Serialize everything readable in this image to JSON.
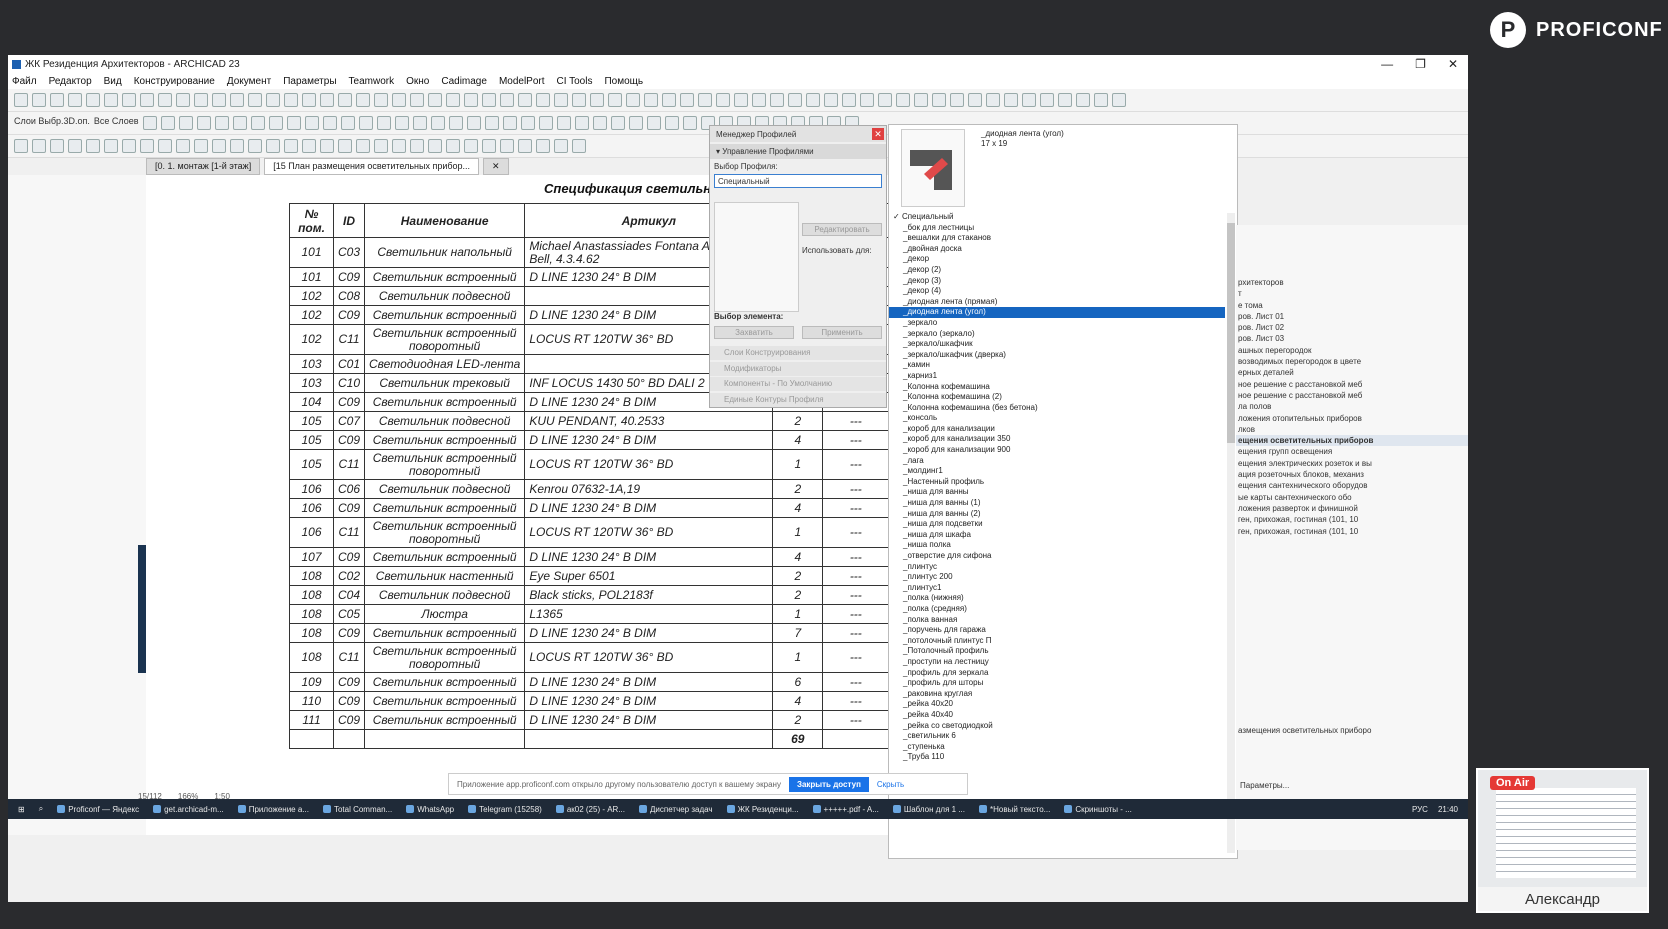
{
  "brand": {
    "logo_letter": "P",
    "name": "PROFICONF"
  },
  "window": {
    "title": "ЖК Резиденция Архитекторов - ARCHICAD 23",
    "min": "—",
    "max": "❐",
    "close": "✕"
  },
  "menu": [
    "Файл",
    "Редактор",
    "Вид",
    "Конструирование",
    "Документ",
    "Параметры",
    "Teamwork",
    "Окно",
    "Cadimage",
    "ModelPort",
    "CI Tools",
    "Помощь"
  ],
  "toolbar2": {
    "layer_combo": "Слои Выбр.3D.оп.",
    "all_layers": "Все Слоев"
  },
  "tabs": [
    {
      "label": "[0. 1. монтаж [1-й этаж]",
      "active": false
    },
    {
      "label": "[15 План размещения осветительных прибор...",
      "active": true
    },
    {
      "label": "✕",
      "active": false
    }
  ],
  "schedule": {
    "title": "Спецификация светильников",
    "headers": [
      "№ пом.",
      "ID",
      "Наименование",
      "Артикул",
      "",
      ""
    ],
    "rows": [
      {
        "room": "101",
        "id": "C03",
        "name": "Светильник напольный",
        "article": "Michael Anastassiades Fontana Amoroso Bell, 4.3.4.62",
        "qty": "",
        "note": "",
        "tall": true
      },
      {
        "room": "101",
        "id": "C09",
        "name": "Светильник встроенный",
        "article": "D LINE 1230 24° B DIM",
        "qty": "",
        "note": "",
        "tall": false
      },
      {
        "room": "102",
        "id": "C08",
        "name": "Светильник подвесной",
        "article": "",
        "qty": "",
        "note": "",
        "tall": false
      },
      {
        "room": "102",
        "id": "C09",
        "name": "Светильник встроенный",
        "article": "D LINE 1230 24° B DIM",
        "qty": "",
        "note": "",
        "tall": false
      },
      {
        "room": "102",
        "id": "C11",
        "name": "Светильник встроенный поворотный",
        "article": "LOCUS RT 120TW 36° BD",
        "qty": "",
        "note": "",
        "tall": true
      },
      {
        "room": "103",
        "id": "C01",
        "name": "Светодиодная LED-лента",
        "article": "",
        "qty": "",
        "note": "",
        "tall": false
      },
      {
        "room": "103",
        "id": "C10",
        "name": "Светильник трековый",
        "article": "INF LOCUS 1430 50° BD DALI 2",
        "qty": "2",
        "note": "",
        "tall": false
      },
      {
        "room": "104",
        "id": "C09",
        "name": "Светильник встроенный",
        "article": "D LINE 1230 24° B DIM",
        "qty": "",
        "note": "---",
        "tall": false
      },
      {
        "room": "105",
        "id": "C07",
        "name": "Светильник подвесной",
        "article": "KUU PENDANT, 40.2533",
        "qty": "2",
        "note": "---",
        "tall": false
      },
      {
        "room": "105",
        "id": "C09",
        "name": "Светильник встроенный",
        "article": "D LINE 1230 24° B DIM",
        "qty": "4",
        "note": "---",
        "tall": false
      },
      {
        "room": "105",
        "id": "C11",
        "name": "Светильник встроенный поворотный",
        "article": "LOCUS RT 120TW 36° BD",
        "qty": "1",
        "note": "---",
        "tall": true
      },
      {
        "room": "106",
        "id": "C06",
        "name": "Светильник подвесной",
        "article": "Kenrou 07632-1A,19",
        "qty": "2",
        "note": "---",
        "tall": false
      },
      {
        "room": "106",
        "id": "C09",
        "name": "Светильник встроенный",
        "article": "D LINE 1230 24° B DIM",
        "qty": "4",
        "note": "---",
        "tall": false
      },
      {
        "room": "106",
        "id": "C11",
        "name": "Светильник встроенный поворотный",
        "article": "LOCUS RT 120TW 36° BD",
        "qty": "1",
        "note": "---",
        "tall": true
      },
      {
        "room": "107",
        "id": "C09",
        "name": "Светильник встроенный",
        "article": "D LINE 1230 24° B DIM",
        "qty": "4",
        "note": "---",
        "tall": false
      },
      {
        "room": "108",
        "id": "C02",
        "name": "Светильник настенный",
        "article": "Eye Super 6501",
        "qty": "2",
        "note": "---",
        "tall": false
      },
      {
        "room": "108",
        "id": "C04",
        "name": "Светильник подвесной",
        "article": "Black sticks, POL2183f",
        "qty": "2",
        "note": "---",
        "tall": false
      },
      {
        "room": "108",
        "id": "C05",
        "name": "Люстра",
        "article": "L1365",
        "qty": "1",
        "note": "---",
        "tall": false
      },
      {
        "room": "108",
        "id": "C09",
        "name": "Светильник встроенный",
        "article": "D LINE 1230 24° B DIM",
        "qty": "7",
        "note": "---",
        "tall": false
      },
      {
        "room": "108",
        "id": "C11",
        "name": "Светильник встроенный поворотный",
        "article": "LOCUS RT 120TW 36° BD",
        "qty": "1",
        "note": "---",
        "tall": true
      },
      {
        "room": "109",
        "id": "C09",
        "name": "Светильник встроенный",
        "article": "D LINE 1230 24° B DIM",
        "qty": "6",
        "note": "---",
        "tall": false
      },
      {
        "room": "110",
        "id": "C09",
        "name": "Светильник встроенный",
        "article": "D LINE 1230 24° B DIM",
        "qty": "4",
        "note": "---",
        "tall": false
      },
      {
        "room": "111",
        "id": "C09",
        "name": "Светильник встроенный",
        "article": "D LINE 1230 24° B DIM",
        "qty": "2",
        "note": "---",
        "tall": false
      }
    ],
    "total": "69"
  },
  "profile_manager": {
    "title": "Менеджер Профилей",
    "close": "✕",
    "section": "Управление Профилями",
    "select_label": "Выбор Профиля:",
    "selected": "Специальный",
    "edit_btn": "Редактировать",
    "use_for": "Использовать для:",
    "element_choice": "Выбор элемента:",
    "capture_btn": "Захватить",
    "apply_btn": "Применить",
    "rows": [
      "Слои Конструирования",
      "Модификаторы",
      "Компоненты - По Умолчанию",
      "Единые Контуры Профиля"
    ]
  },
  "profile_list": {
    "preview_name": "_диодная лента (угол)",
    "dims": "17 x 19",
    "items": [
      {
        "label": "Специальный",
        "checked": true,
        "selected": false
      },
      {
        "label": "_бок для лестницы",
        "checked": false,
        "selected": false
      },
      {
        "label": "_вешалки для стаканов",
        "checked": false,
        "selected": false
      },
      {
        "label": "_двойная доска",
        "checked": false,
        "selected": false
      },
      {
        "label": "_декор",
        "checked": false,
        "selected": false
      },
      {
        "label": "_декор (2)",
        "checked": false,
        "selected": false
      },
      {
        "label": "_декор (3)",
        "checked": false,
        "selected": false
      },
      {
        "label": "_декор (4)",
        "checked": false,
        "selected": false
      },
      {
        "label": "_диодная лента (прямая)",
        "checked": false,
        "selected": false
      },
      {
        "label": "_диодная лента (угол)",
        "checked": false,
        "selected": true
      },
      {
        "label": "_зеркало",
        "checked": false,
        "selected": false
      },
      {
        "label": "_зеркало (зеркало)",
        "checked": false,
        "selected": false
      },
      {
        "label": "_зеркало/шкафчик",
        "checked": false,
        "selected": false
      },
      {
        "label": "_зеркало/шкафчик (дверка)",
        "checked": false,
        "selected": false
      },
      {
        "label": "_камин",
        "checked": false,
        "selected": false
      },
      {
        "label": "_карниз1",
        "checked": false,
        "selected": false
      },
      {
        "label": "_Колонна кофемашина",
        "checked": false,
        "selected": false
      },
      {
        "label": "_Колонна кофемашина (2)",
        "checked": false,
        "selected": false
      },
      {
        "label": "_Колонна кофемашина (без бетона)",
        "checked": false,
        "selected": false
      },
      {
        "label": "_консоль",
        "checked": false,
        "selected": false
      },
      {
        "label": "_короб для канализации",
        "checked": false,
        "selected": false
      },
      {
        "label": "_короб для канализации 350",
        "checked": false,
        "selected": false
      },
      {
        "label": "_короб для канализации 900",
        "checked": false,
        "selected": false
      },
      {
        "label": "_лага",
        "checked": false,
        "selected": false
      },
      {
        "label": "_молдинг1",
        "checked": false,
        "selected": false
      },
      {
        "label": "_Настенный профиль",
        "checked": false,
        "selected": false
      },
      {
        "label": "_ниша для ванны",
        "checked": false,
        "selected": false
      },
      {
        "label": "_ниша для ванны (1)",
        "checked": false,
        "selected": false
      },
      {
        "label": "_ниша для ванны (2)",
        "checked": false,
        "selected": false
      },
      {
        "label": "_ниша для подсветки",
        "checked": false,
        "selected": false
      },
      {
        "label": "_ниша для шкафа",
        "checked": false,
        "selected": false
      },
      {
        "label": "_ниша полка",
        "checked": false,
        "selected": false
      },
      {
        "label": "_отверстие для сифона",
        "checked": false,
        "selected": false
      },
      {
        "label": "_плинтус",
        "checked": false,
        "selected": false
      },
      {
        "label": "_плинтус 200",
        "checked": false,
        "selected": false
      },
      {
        "label": "_плинтус1",
        "checked": false,
        "selected": false
      },
      {
        "label": "_полка (нижняя)",
        "checked": false,
        "selected": false
      },
      {
        "label": "_полка (средняя)",
        "checked": false,
        "selected": false
      },
      {
        "label": "_полка ванная",
        "checked": false,
        "selected": false
      },
      {
        "label": "_поручень для гаража",
        "checked": false,
        "selected": false
      },
      {
        "label": "_потолочный плинтус П",
        "checked": false,
        "selected": false
      },
      {
        "label": "_Потолочный профиль",
        "checked": false,
        "selected": false
      },
      {
        "label": "_проступи на лестницу",
        "checked": false,
        "selected": false
      },
      {
        "label": "_профиль для зеркала",
        "checked": false,
        "selected": false
      },
      {
        "label": "_профиль для шторы",
        "checked": false,
        "selected": false
      },
      {
        "label": "_раковина круглая",
        "checked": false,
        "selected": false
      },
      {
        "label": "_рейка 40x20",
        "checked": false,
        "selected": false
      },
      {
        "label": "_рейка 40x40",
        "checked": false,
        "selected": false
      },
      {
        "label": "_рейка со светодиодкой",
        "checked": false,
        "selected": false
      },
      {
        "label": "_светильник 6",
        "checked": false,
        "selected": false
      },
      {
        "label": "_ступенька",
        "checked": false,
        "selected": false
      },
      {
        "label": "_Труба 110",
        "checked": false,
        "selected": false
      }
    ]
  },
  "navigator": {
    "items": [
      {
        "label": "рхитекторов",
        "sel": false
      },
      {
        "label": "т",
        "sel": false
      },
      {
        "label": "е тома",
        "sel": false
      },
      {
        "label": "ров. Лист 01",
        "sel": false
      },
      {
        "label": "ров. Лист 02",
        "sel": false
      },
      {
        "label": "ров. Лист 03",
        "sel": false
      },
      {
        "label": "ашных перегородок",
        "sel": false
      },
      {
        "label": "возводимых перегородок в цвете",
        "sel": false
      },
      {
        "label": "ерных деталей",
        "sel": false
      },
      {
        "label": "ное решение с расстановкой меб",
        "sel": false
      },
      {
        "label": "ное решение с расстановкой меб",
        "sel": false
      },
      {
        "label": "ла полов",
        "sel": false
      },
      {
        "label": "ложения отопительных приборов",
        "sel": false
      },
      {
        "label": "лков",
        "sel": false
      },
      {
        "label": "ещения осветительных приборов",
        "sel": true
      },
      {
        "label": "ещения групп освещения",
        "sel": false
      },
      {
        "label": "ещения электрических розеток и вы",
        "sel": false
      },
      {
        "label": "ация розеточных блоков, механиз",
        "sel": false
      },
      {
        "label": "ещения сантехнического оборудов",
        "sel": false
      },
      {
        "label": "ые карты сантехнического обо",
        "sel": false
      },
      {
        "label": "ложения разверток и финишной",
        "sel": false
      },
      {
        "label": "ген, прихожая, гостиная (101, 10",
        "sel": false
      },
      {
        "label": "ген, прихожая, гостиная (101, 10",
        "sel": false
      }
    ],
    "bottom_item": "азмещения осветительных приборо",
    "params": "Параметры..."
  },
  "notice": {
    "text": "Приложение app.proficonf.com открыло другому пользователю доступ к вашему экрану",
    "close_access": "Закрыть доступ",
    "hide": "Скрыть"
  },
  "statusbar": {
    "page": "15/112",
    "zoom": "166%",
    "scale": "1:50"
  },
  "taskbar": {
    "items": [
      "Proficonf — Яндекс",
      "get.archicad-m...",
      "Приложение а...",
      "Total Comman...",
      "WhatsApp",
      "Telegram (15258)",
      "ак02 (25) - AR...",
      "Диспетчер задач",
      "ЖК Резиденци...",
      "+++++.pdf - A...",
      "Шаблон для 1 ...",
      "*Новый тексто...",
      "Скриншоты - ..."
    ],
    "lang": "РУС",
    "time": "21:40"
  },
  "webcam": {
    "onair": "On Air",
    "name": "Александр"
  }
}
